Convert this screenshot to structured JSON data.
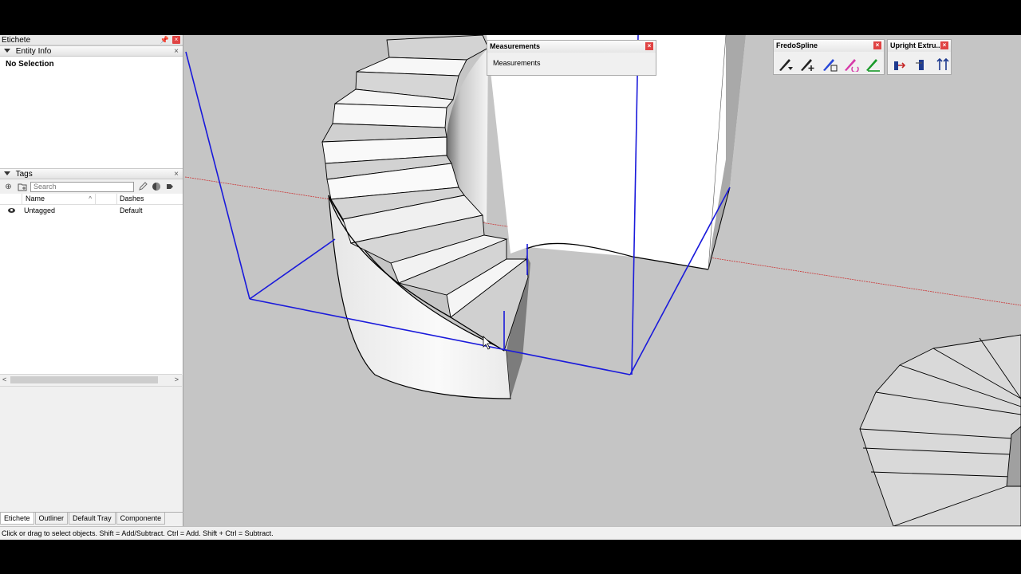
{
  "tray": {
    "title": "Etichete",
    "entity_info": {
      "header": "Entity Info",
      "selection_text": "No Selection"
    },
    "tags": {
      "header": "Tags",
      "search_placeholder": "Search",
      "columns": [
        "Name",
        "Dashes"
      ],
      "rows": [
        {
          "name": "Untagged",
          "dashes": "Default"
        }
      ]
    },
    "bottom_tabs": [
      "Etichete",
      "Outliner",
      "Default Tray",
      "Componente"
    ]
  },
  "measurements": {
    "title": "Measurements",
    "label": "Measurements"
  },
  "toolbars": [
    {
      "title": "FredoSpline",
      "icons": [
        "fredospline-draw-icon",
        "fredospline-add-icon",
        "fredospline-edit-icon",
        "fredospline-convert-icon",
        "fredospline-green-icon"
      ]
    },
    {
      "title": "Upright Extru...",
      "icons": [
        "extrude-arrow-icon",
        "extrude-face-icon",
        "extrude-up-icon"
      ]
    }
  ],
  "status_bar": {
    "text": "Click or drag to select objects. Shift = Add/Subtract. Ctrl = Add. Shift + Ctrl = Subtract."
  },
  "colors": {
    "viewport_bg": "#c5c5c5",
    "selection_blue": "#1a1adb",
    "axis_red": "#cc3333",
    "close_red": "#e04343"
  }
}
